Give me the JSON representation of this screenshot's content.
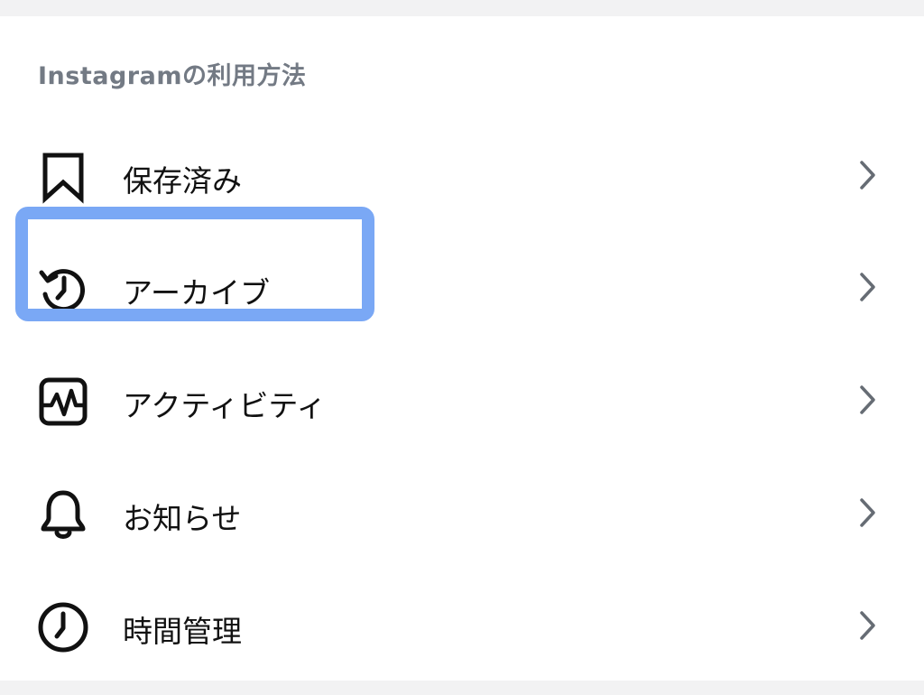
{
  "section": {
    "title": "Instagramの利用方法"
  },
  "items": [
    {
      "label": "保存済み",
      "icon": "bookmark-icon"
    },
    {
      "label": "アーカイブ",
      "icon": "archive-history-icon"
    },
    {
      "label": "アクティビティ",
      "icon": "activity-icon"
    },
    {
      "label": "お知らせ",
      "icon": "bell-icon"
    },
    {
      "label": "時間管理",
      "icon": "clock-icon"
    }
  ],
  "colors": {
    "highlight": "#7aa8f5",
    "section_title": "#737a84",
    "chevron": "#666c74",
    "icon": "#111111"
  }
}
